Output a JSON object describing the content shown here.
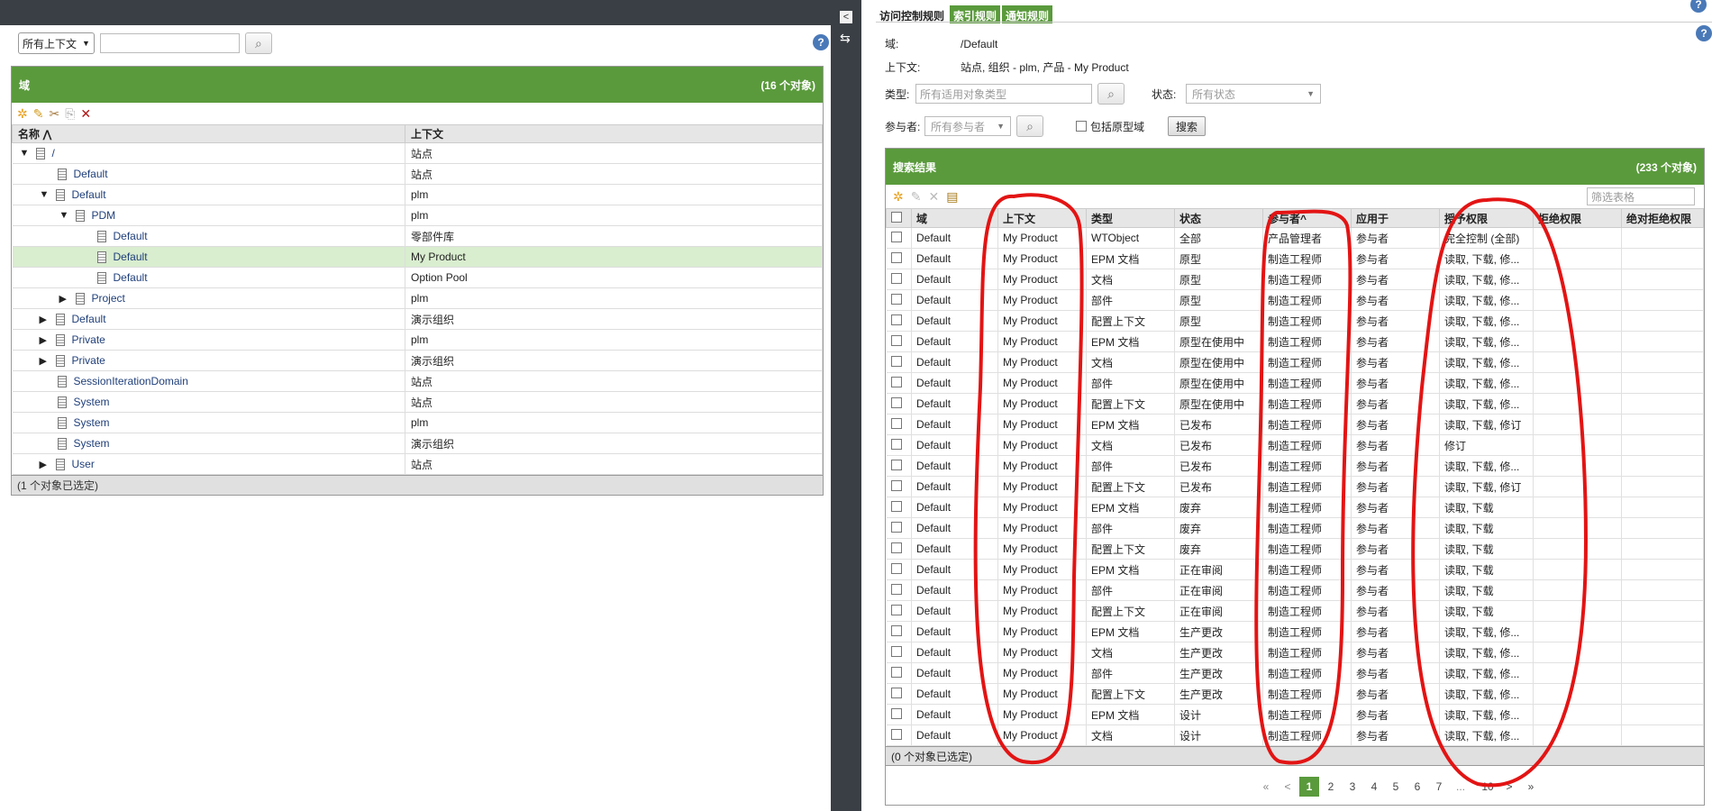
{
  "left": {
    "context_select": "所有上下文",
    "search_value": "",
    "help": "?",
    "panel_title": "域",
    "panel_count": "(16 个对象)",
    "col_name": "名称 ⋀",
    "col_context": "上下文",
    "footer": "(1 个对象已选定)",
    "rows": [
      {
        "name": "/",
        "context": "站点",
        "indent": 0,
        "tri": "▼",
        "selected": false
      },
      {
        "name": "Default",
        "context": "站点",
        "indent": 1,
        "tri": "",
        "selected": false
      },
      {
        "name": "Default",
        "context": "plm",
        "indent": 1,
        "tri": "▼",
        "selected": false
      },
      {
        "name": "PDM",
        "context": "plm",
        "indent": 2,
        "tri": "▼",
        "selected": false
      },
      {
        "name": "Default",
        "context": "零部件库",
        "indent": 3,
        "tri": "",
        "selected": false
      },
      {
        "name": "Default",
        "context": "My Product",
        "indent": 3,
        "tri": "",
        "selected": true
      },
      {
        "name": "Default",
        "context": "Option Pool",
        "indent": 3,
        "tri": "",
        "selected": false
      },
      {
        "name": "Project",
        "context": "plm",
        "indent": 2,
        "tri": "▶",
        "selected": false
      },
      {
        "name": "Default",
        "context": "演示组织",
        "indent": 1,
        "tri": "▶",
        "selected": false
      },
      {
        "name": "Private",
        "context": "plm",
        "indent": 1,
        "tri": "▶",
        "selected": false
      },
      {
        "name": "Private",
        "context": "演示组织",
        "indent": 1,
        "tri": "▶",
        "selected": false
      },
      {
        "name": "SessionIterationDomain",
        "context": "站点",
        "indent": 1,
        "tri": "",
        "selected": false
      },
      {
        "name": "System",
        "context": "站点",
        "indent": 1,
        "tri": "",
        "selected": false
      },
      {
        "name": "System",
        "context": "plm",
        "indent": 1,
        "tri": "",
        "selected": false
      },
      {
        "name": "System",
        "context": "演示组织",
        "indent": 1,
        "tri": "",
        "selected": false
      },
      {
        "name": "User",
        "context": "站点",
        "indent": 1,
        "tri": "▶",
        "selected": false
      }
    ]
  },
  "divider": {
    "collapse": "<",
    "side_icon": "⇆"
  },
  "right": {
    "tabs": [
      "访问控制规则",
      "索引规则",
      "通知规则"
    ],
    "domain_label": "域:",
    "domain_value": "/Default",
    "context_label": "上下文:",
    "context_value": "站点, 组织 - plm, 产品 - My Product",
    "type_label": "类型:",
    "type_placeholder": "所有适用对象类型",
    "state_label": "状态:",
    "state_value": "所有状态",
    "participant_label": "参与者:",
    "participant_value": "所有参与者",
    "include_proto_label": "包括原型域",
    "search_button": "搜索",
    "results_title": "搜索结果",
    "results_count": "(233 个对象)",
    "filter_placeholder": "筛选表格",
    "columns": [
      "域",
      "上下文",
      "类型",
      "状态",
      "参与者^",
      "应用于",
      "授予权限",
      "拒绝权限",
      "绝对拒绝权限"
    ],
    "rows": [
      [
        "Default",
        "My Product",
        "WTObject",
        "全部",
        "产品管理者",
        "参与者",
        "完全控制 (全部)"
      ],
      [
        "Default",
        "My Product",
        "EPM 文档",
        "原型",
        "制造工程师",
        "参与者",
        "读取, 下载, 修..."
      ],
      [
        "Default",
        "My Product",
        "文档",
        "原型",
        "制造工程师",
        "参与者",
        "读取, 下载, 修..."
      ],
      [
        "Default",
        "My Product",
        "部件",
        "原型",
        "制造工程师",
        "参与者",
        "读取, 下载, 修..."
      ],
      [
        "Default",
        "My Product",
        "配置上下文",
        "原型",
        "制造工程师",
        "参与者",
        "读取, 下载, 修..."
      ],
      [
        "Default",
        "My Product",
        "EPM 文档",
        "原型在使用中",
        "制造工程师",
        "参与者",
        "读取, 下载, 修..."
      ],
      [
        "Default",
        "My Product",
        "文档",
        "原型在使用中",
        "制造工程师",
        "参与者",
        "读取, 下载, 修..."
      ],
      [
        "Default",
        "My Product",
        "部件",
        "原型在使用中",
        "制造工程师",
        "参与者",
        "读取, 下载, 修..."
      ],
      [
        "Default",
        "My Product",
        "配置上下文",
        "原型在使用中",
        "制造工程师",
        "参与者",
        "读取, 下载, 修..."
      ],
      [
        "Default",
        "My Product",
        "EPM 文档",
        "已发布",
        "制造工程师",
        "参与者",
        "读取, 下载, 修订"
      ],
      [
        "Default",
        "My Product",
        "文档",
        "已发布",
        "制造工程师",
        "参与者",
        "修订"
      ],
      [
        "Default",
        "My Product",
        "部件",
        "已发布",
        "制造工程师",
        "参与者",
        "读取, 下载, 修..."
      ],
      [
        "Default",
        "My Product",
        "配置上下文",
        "已发布",
        "制造工程师",
        "参与者",
        "读取, 下载, 修订"
      ],
      [
        "Default",
        "My Product",
        "EPM 文档",
        "废弃",
        "制造工程师",
        "参与者",
        "读取, 下载"
      ],
      [
        "Default",
        "My Product",
        "部件",
        "废弃",
        "制造工程师",
        "参与者",
        "读取, 下载"
      ],
      [
        "Default",
        "My Product",
        "配置上下文",
        "废弃",
        "制造工程师",
        "参与者",
        "读取, 下载"
      ],
      [
        "Default",
        "My Product",
        "EPM 文档",
        "正在审阅",
        "制造工程师",
        "参与者",
        "读取, 下载"
      ],
      [
        "Default",
        "My Product",
        "部件",
        "正在审阅",
        "制造工程师",
        "参与者",
        "读取, 下载"
      ],
      [
        "Default",
        "My Product",
        "配置上下文",
        "正在审阅",
        "制造工程师",
        "参与者",
        "读取, 下载"
      ],
      [
        "Default",
        "My Product",
        "EPM 文档",
        "生产更改",
        "制造工程师",
        "参与者",
        "读取, 下载, 修..."
      ],
      [
        "Default",
        "My Product",
        "文档",
        "生产更改",
        "制造工程师",
        "参与者",
        "读取, 下载, 修..."
      ],
      [
        "Default",
        "My Product",
        "部件",
        "生产更改",
        "制造工程师",
        "参与者",
        "读取, 下载, 修..."
      ],
      [
        "Default",
        "My Product",
        "配置上下文",
        "生产更改",
        "制造工程师",
        "参与者",
        "读取, 下载, 修..."
      ],
      [
        "Default",
        "My Product",
        "EPM 文档",
        "设计",
        "制造工程师",
        "参与者",
        "读取, 下载, 修..."
      ],
      [
        "Default",
        "My Product",
        "文档",
        "设计",
        "制造工程师",
        "参与者",
        "读取, 下载, 修..."
      ]
    ],
    "footer": "(0 个对象已选定)",
    "pager": {
      "first": "«",
      "prev": "<",
      "pages": [
        "1",
        "2",
        "3",
        "4",
        "5",
        "6",
        "7"
      ],
      "ellipsis": "...",
      "last_page": "10",
      "next": ">",
      "last": "»",
      "current": "1"
    }
  }
}
